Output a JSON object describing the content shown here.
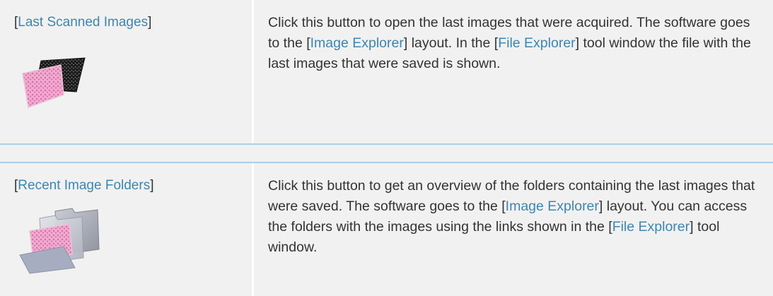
{
  "rows": [
    {
      "name": "Last Scanned Images",
      "icon": "scanned-images-icon",
      "description_parts": [
        {
          "text": "Click this button to open the last images that were acquired. The software goes to the [",
          "link": false
        },
        {
          "text": "Image Explorer",
          "link": true
        },
        {
          "text": "] layout. In the [",
          "link": false
        },
        {
          "text": "File Explorer",
          "link": true
        },
        {
          "text": "] tool window the file with the last images that were saved is shown.",
          "link": false
        }
      ]
    },
    {
      "name": "Recent Image Folders",
      "icon": "recent-folders-icon",
      "description_parts": [
        {
          "text": "Click this button to get an overview of the folders containing the last images that were saved. The software goes to the [",
          "link": false
        },
        {
          "text": "Image Explorer",
          "link": true
        },
        {
          "text": "] layout. You can access the folders with the images using the links shown in the [",
          "link": false
        },
        {
          "text": "File Explorer",
          "link": true
        },
        {
          "text": "] tool window.",
          "link": false
        }
      ]
    }
  ],
  "colors": {
    "link": "#3d86b0",
    "row_background": "#f1f1f1",
    "separator": "#a9cfe6"
  }
}
